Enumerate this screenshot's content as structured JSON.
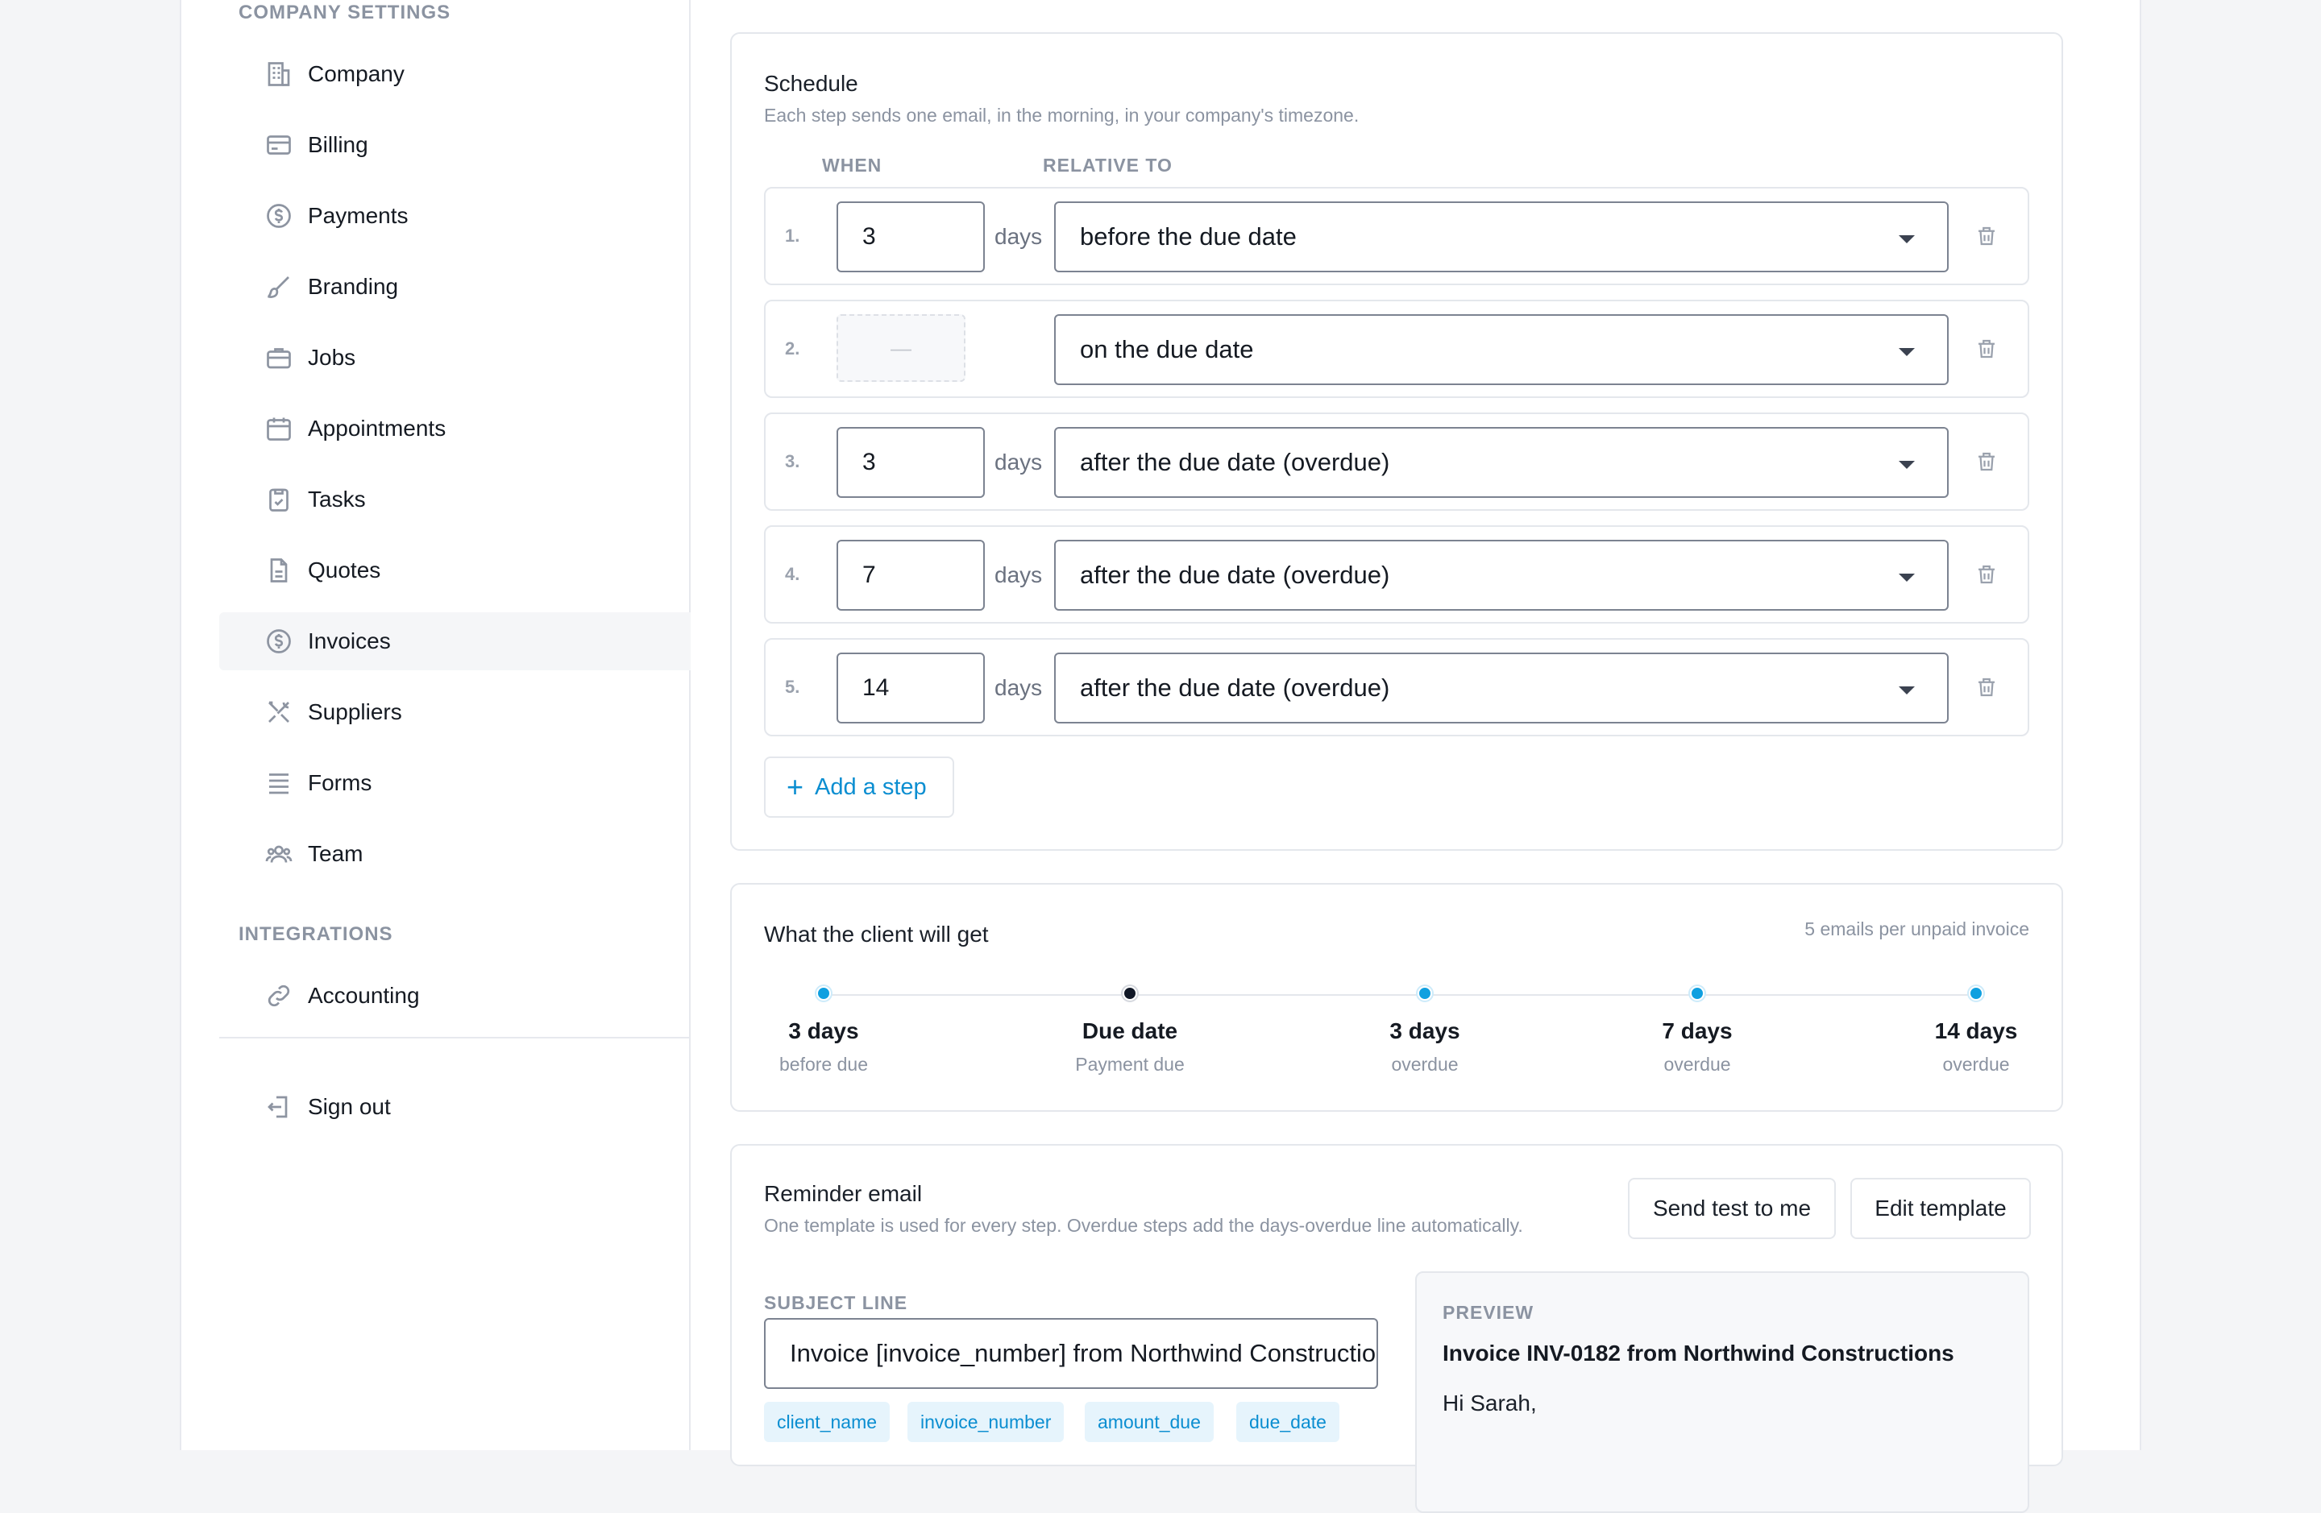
{
  "sidebar": {
    "company_section_label": "COMPANY SETTINGS",
    "integrations_section_label": "INTEGRATIONS",
    "items": [
      {
        "label": "Company",
        "icon": "building-icon"
      },
      {
        "label": "Billing",
        "icon": "credit-card-icon"
      },
      {
        "label": "Payments",
        "icon": "dollar-circle-icon"
      },
      {
        "label": "Branding",
        "icon": "brush-icon"
      },
      {
        "label": "Jobs",
        "icon": "briefcase-icon"
      },
      {
        "label": "Appointments",
        "icon": "calendar-icon"
      },
      {
        "label": "Tasks",
        "icon": "clipboard-check-icon"
      },
      {
        "label": "Quotes",
        "icon": "document-icon"
      },
      {
        "label": "Invoices",
        "icon": "dollar-circle-icon",
        "active": true
      },
      {
        "label": "Suppliers",
        "icon": "tools-icon"
      },
      {
        "label": "Forms",
        "icon": "list-icon"
      },
      {
        "label": "Team",
        "icon": "users-icon"
      }
    ],
    "integrations": [
      {
        "label": "Accounting",
        "icon": "link-icon"
      }
    ],
    "sign_out": {
      "label": "Sign out",
      "icon": "sign-out-icon"
    }
  },
  "schedule": {
    "title": "Schedule",
    "subtitle": "Each step sends one email, in the morning, in your company's timezone.",
    "col_when": "WHEN",
    "col_relative": "RELATIVE TO",
    "days_word": "days",
    "disabled_placeholder": "—",
    "steps": [
      {
        "num": "1.",
        "days": "3",
        "relative": "before the due date"
      },
      {
        "num": "2.",
        "days": "",
        "relative": "on the due date"
      },
      {
        "num": "3.",
        "days": "3",
        "relative": "after the due date (overdue)"
      },
      {
        "num": "4.",
        "days": "7",
        "relative": "after the due date (overdue)"
      },
      {
        "num": "5.",
        "days": "14",
        "relative": "after the due date (overdue)"
      }
    ],
    "add_step_label": "Add a step"
  },
  "client_view": {
    "title": "What the client will get",
    "count_text": "5 emails per unpaid invoice",
    "points": [
      {
        "title": "3 days",
        "sub": "before due"
      },
      {
        "title": "Due date",
        "sub": "Payment due"
      },
      {
        "title": "3 days",
        "sub": "overdue"
      },
      {
        "title": "7 days",
        "sub": "overdue"
      },
      {
        "title": "14 days",
        "sub": "overdue"
      }
    ]
  },
  "reminder": {
    "title": "Reminder email",
    "subtitle": "One template is used for every step. Overdue steps add the days-overdue line automatically.",
    "send_test_label": "Send test to me",
    "edit_template_label": "Edit template",
    "subject_label": "SUBJECT LINE",
    "subject_value": "Invoice [invoice_number] from Northwind Constructions",
    "tokens": [
      "client_name",
      "invoice_number",
      "amount_due",
      "due_date"
    ],
    "preview_label": "PREVIEW",
    "preview_title": "Invoice INV-0182 from Northwind Constructions",
    "preview_greeting": "Hi Sarah,"
  },
  "colors": {
    "accent": "#0b8ed1",
    "timeline_dot": "#10a0e0",
    "due_dot": "#111827"
  }
}
